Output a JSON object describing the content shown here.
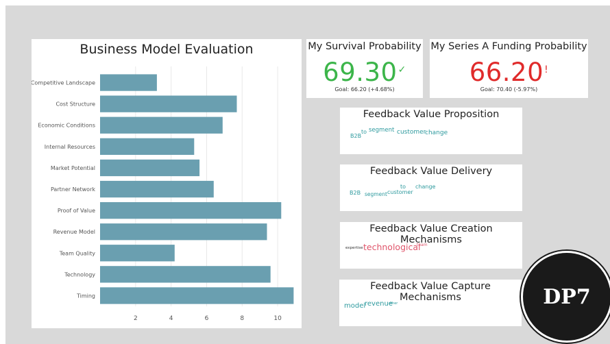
{
  "chart_data": {
    "type": "bar",
    "orientation": "horizontal",
    "title": "Business Model Evaluation",
    "categories": [
      "Competitive Landscape",
      "Cost Structure",
      "Economic Conditions",
      "Internal Resources",
      "Market Potential",
      "Partner Network",
      "Proof of Value",
      "Revenue Model",
      "Team Quality",
      "Technology",
      "Timing"
    ],
    "values": [
      3.2,
      7.7,
      6.9,
      5.3,
      5.6,
      6.4,
      10.2,
      9.4,
      4.2,
      9.6,
      10.9
    ],
    "xticks": [
      "2",
      "4",
      "6",
      "8",
      "10"
    ],
    "xlim": [
      0,
      11
    ],
    "grid": "vertical",
    "bar_color": "#6a9fb0"
  },
  "kpis": [
    {
      "title": "My Survival Probability",
      "value": "69.30",
      "status_glyph": "✓",
      "color": "#3cb54a",
      "goal": "Goal: 66.20 (+4.68%)"
    },
    {
      "title": "My Series A Funding Probability",
      "value": "66.20",
      "status_glyph": "!",
      "color": "#e02b2b",
      "goal": "Goal: 70.40 (-5.97%)"
    }
  ],
  "feedback": [
    {
      "title": "Feedback Value Proposition",
      "words": [
        "B2B",
        "to",
        "segment",
        "customer",
        "change"
      ]
    },
    {
      "title": "Feedback Value Delivery",
      "words": [
        "B2B",
        "segment",
        "customer",
        "to",
        "change"
      ]
    },
    {
      "title": "Feedback Value Creation Mechanisms",
      "words": [
        "expertise",
        "technological",
        "team"
      ]
    },
    {
      "title": "Feedback Value Capture Mechanisms",
      "words": [
        "model",
        "revenue",
        "other"
      ]
    }
  ],
  "badge": "DP7"
}
